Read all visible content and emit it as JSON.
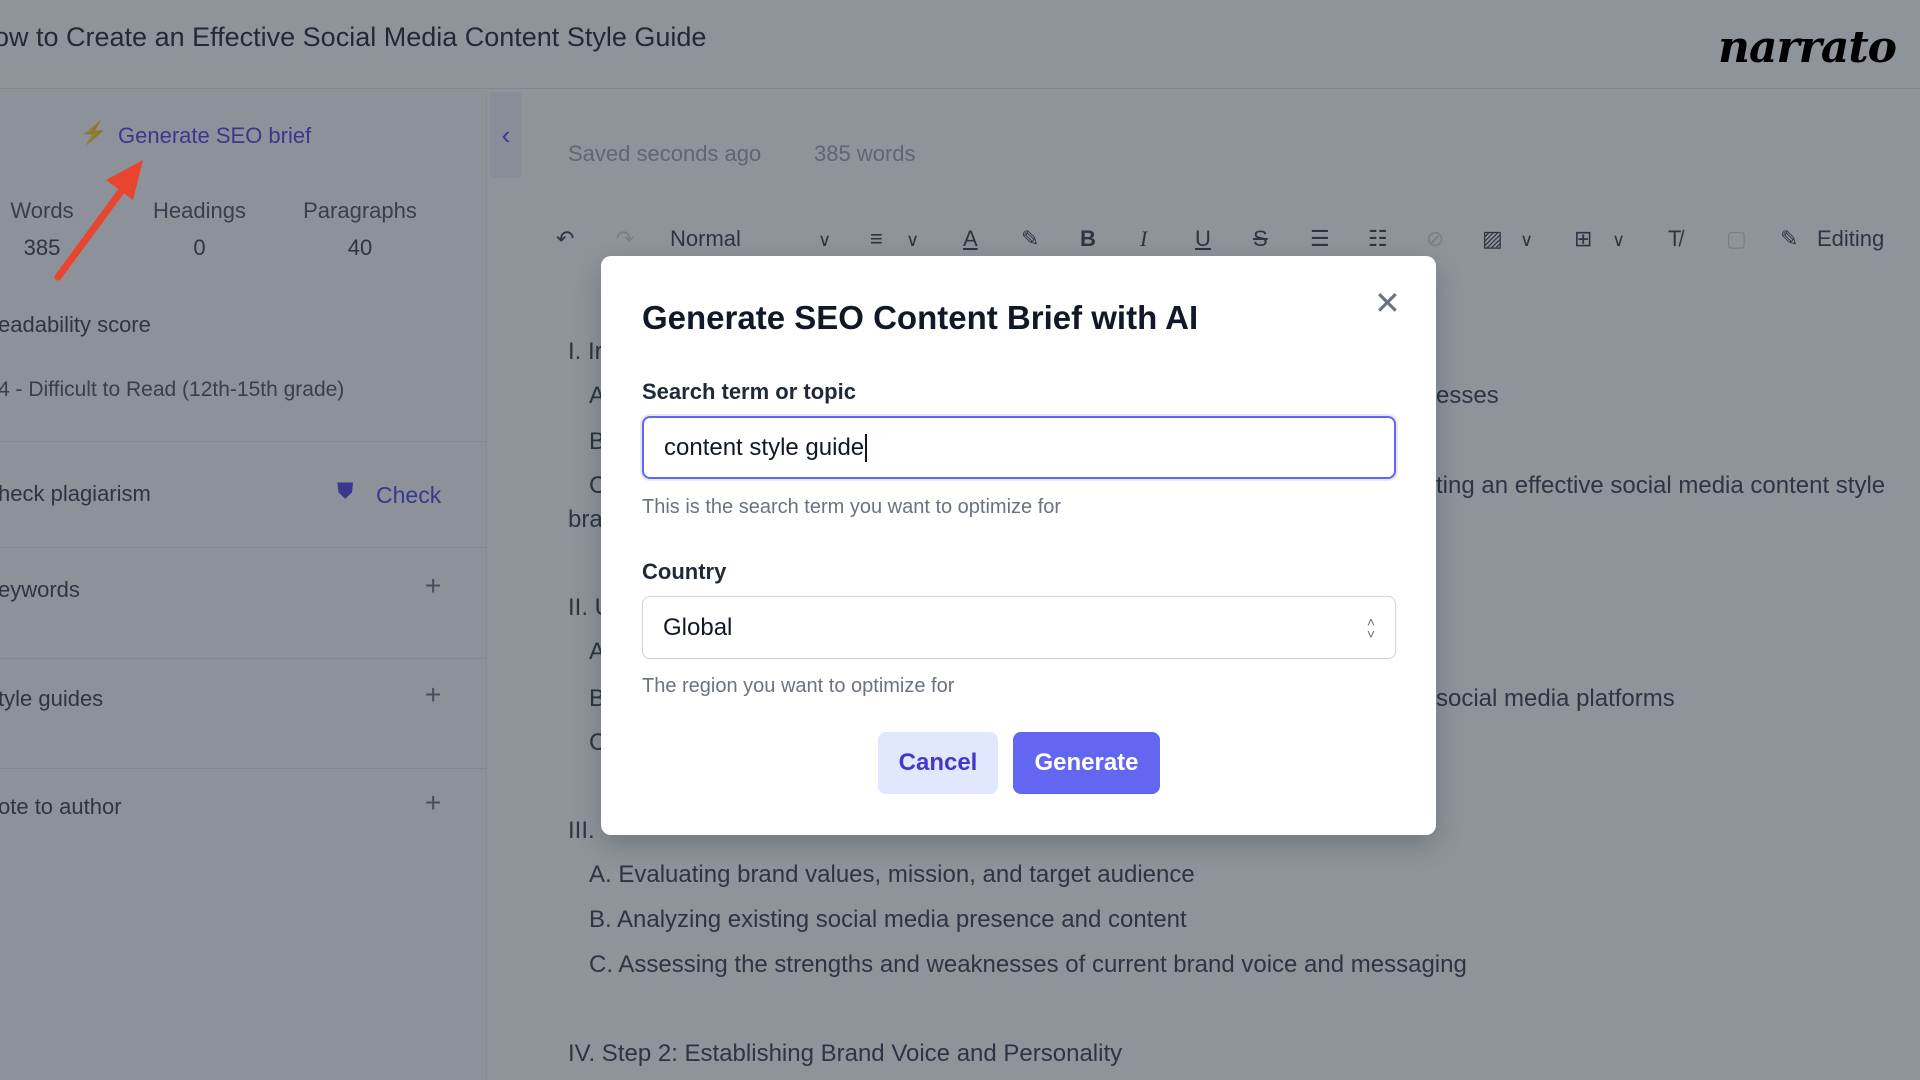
{
  "header": {
    "title": "ow to Create an Effective Social Media Content Style Guide",
    "logo": "narrato"
  },
  "sidebar": {
    "generate_seo_brief": "Generate SEO brief",
    "stats": [
      {
        "label": "Words",
        "value": "385"
      },
      {
        "label": "Headings",
        "value": "0"
      },
      {
        "label": "Paragraphs",
        "value": "40"
      }
    ],
    "readability_label": "eadability score",
    "readability_value": "4 - Difficult to Read (12th-15th grade)",
    "plagiarism_label": "heck plagiarism",
    "check_label": "Check",
    "keywords_label": "eywords",
    "style_guides_label": "tyle guides",
    "note_label": "ote to author",
    "accent_color": "#6366f1"
  },
  "editor": {
    "saved": "Saved seconds ago",
    "word_count": "385 words",
    "toolbar": {
      "style": "Normal",
      "mode": "Editing"
    },
    "lines": {
      "l1": "I. Ir",
      "l2a": "A",
      "l2b": "esses",
      "l3": "B",
      "l4a": "C",
      "l4b": "ting an effective social media content style",
      "l5": "bra",
      "l6": "II. U",
      "l7": "A",
      "l8a": "B",
      "l8b": "social media platforms",
      "l9": "C",
      "l10": "III. ",
      "l11": "A. Evaluating brand values, mission, and target audience",
      "l12": "B. Analyzing existing social media presence and content",
      "l13": "C. Assessing the strengths and weaknesses of current brand voice and messaging",
      "l14": "IV. Step 2: Establishing Brand Voice and Personality"
    }
  },
  "modal": {
    "title": "Generate SEO Content Brief with AI",
    "search_label": "Search term or topic",
    "search_value": "content style guide",
    "search_help": "This is the search term you want to optimize for",
    "country_label": "Country",
    "country_value": "Global",
    "country_help": "The region you want to optimize for",
    "cancel": "Cancel",
    "generate": "Generate",
    "primary_color": "#6366f1"
  }
}
